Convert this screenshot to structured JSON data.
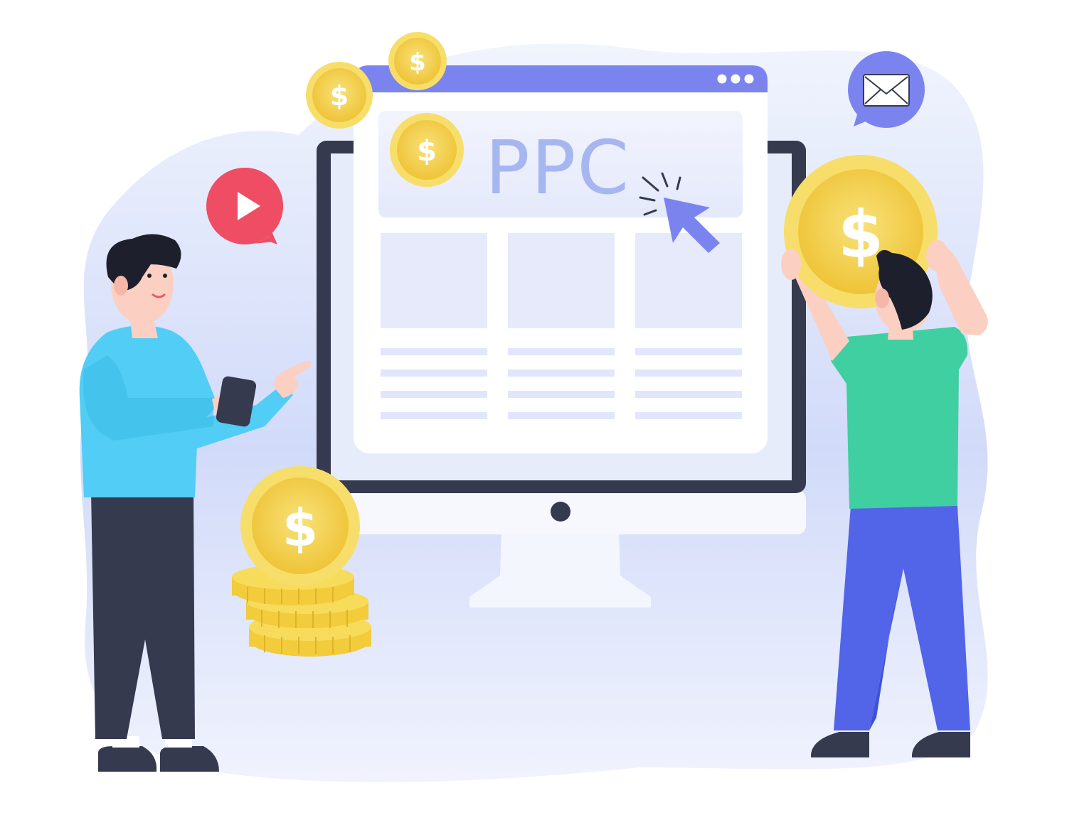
{
  "illustration": {
    "screen_heading": "PPC",
    "coin_symbol": "$"
  },
  "icons": {
    "video": "play-icon",
    "message": "envelope-icon",
    "pointer": "cursor-arrow-icon",
    "currency": "dollar-coin-icon",
    "menu": "three-dots-icon"
  },
  "colors": {
    "background_blob": "#dfe6fb",
    "browser_bar": "#7b84ee",
    "monitor_frame": "#363a4f",
    "ppc_text": "#a6b6f0",
    "coin_gold": "#f2cc3a",
    "play_red": "#ef4d64",
    "envelope_blue": "#7b84ee",
    "shirt_left": "#52cdf5",
    "shirt_right": "#3fcfa1",
    "pants_left": "#363a4f",
    "pants_right": "#5264e8"
  }
}
